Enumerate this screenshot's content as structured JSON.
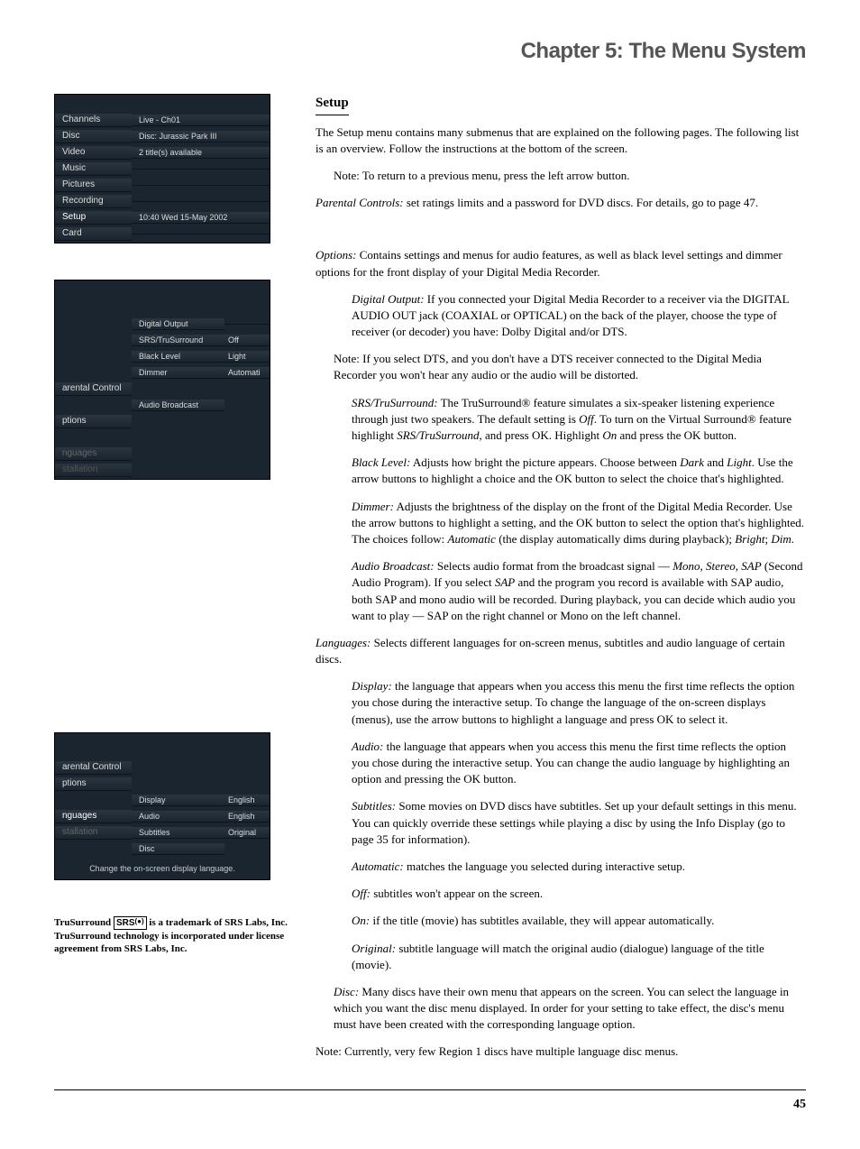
{
  "chapter_title": "Chapter 5: The Menu System",
  "setup": {
    "heading": "Setup",
    "intro": "The Setup menu contains many submenus that are explained on the following pages. The following list is an overview. Follow the instructions at the bottom of the screen.",
    "note_return": "Note: To return to a previous menu, press the left arrow button.",
    "parental_label": "Parental Controls:",
    "parental_text": " set ratings limits and a password for DVD discs. For details, go to page 47.",
    "options_label": "Options:",
    "options_text": " Contains settings and menus for audio features, as well as black level settings and dimmer options for the front display of your Digital Media Recorder.",
    "digital_output_label": "Digital Output:",
    "digital_output_text": "  If you connected your Digital Media Recorder to a receiver via the DIGITAL AUDIO OUT jack (COAXIAL or OPTICAL) on the back of the player, choose the type of receiver (or decoder) you have: Dolby Digital and/or DTS.",
    "dts_note": "Note: If you select DTS, and you don't have a DTS receiver connected to the Digital Media Recorder you won't hear any audio or the audio will be distorted.",
    "srs_label": "SRS/TruSurround:",
    "srs_text_1": "  The TruSurround® feature simulates a six-speaker listening experience through just two speakers. The default setting is ",
    "srs_off": "Off",
    "srs_text_2": ". To turn on the Virtual Surround® feature highlight ",
    "srs_highlight": "SRS/TruSurround",
    "srs_text_3": ", and press OK. Highlight ",
    "srs_on": "On",
    "srs_text_4": " and press the OK button.",
    "black_label": "Black Level:",
    "black_text_1": "  Adjusts how bright the picture appears. Choose between ",
    "black_dark": "Dark",
    "black_and": " and ",
    "black_light": "Light",
    "black_text_2": ". Use the arrow buttons to highlight a choice and the OK button to select the choice that's highlighted.",
    "dimmer_label": "Dimmer:",
    "dimmer_text_1": " Adjusts the brightness of the display on the front of the Digital Media Recorder. Use the arrow buttons to highlight a setting, and the OK button to select the option that's highlighted. The choices follow: ",
    "dimmer_auto": "Automatic",
    "dimmer_text_2": " (the display automatically dims during playback); ",
    "dimmer_bright": "Bright",
    "dimmer_semi": "; ",
    "dimmer_dim": "Dim",
    "dimmer_period": ".",
    "audio_bc_label": "Audio Broadcast:",
    "audio_bc_text_1": "  Selects audio format from the broadcast signal — ",
    "audio_bc_modes": "Mono, Stereo, SAP",
    "audio_bc_text_2": " (Second Audio Program). If you select ",
    "audio_bc_sap": "SAP",
    "audio_bc_text_3": " and the program you record is available with SAP audio, both SAP and mono audio will be recorded. During playback, you can decide which audio you want to play — SAP on the right channel or Mono on the left channel.",
    "lang_label": "Languages:",
    "lang_text": " Selects different languages for on-screen menus, subtitles and audio language of certain discs.",
    "display_label": "Display:",
    "display_text": " the language that appears when you access this menu the first time reflects the option you chose during the interactive setup. To change the language of the on-screen displays (menus), use the arrow buttons to highlight a language and press OK to select it.",
    "audio_label": "Audio:",
    "audio_text": " the language that appears when you access this menu the first time reflects the option you chose during the interactive setup. You can change the audio language by highlighting an option and pressing the OK button.",
    "subtitles_label": "Subtitles:",
    "subtitles_text": " Some movies on DVD discs have subtitles. Set up your default settings in this menu. You can quickly override these settings while playing a disc by using the Info Display (go to page 35 for information).",
    "sub_auto_label": "Automatic:",
    "sub_auto_text": " matches the language you selected during interactive setup.",
    "sub_off_label": "Off:",
    "sub_off_text": " subtitles won't appear on the screen.",
    "sub_on_label": "On:",
    "sub_on_text": " if the title (movie) has subtitles available, they will appear automatically.",
    "sub_orig_label": "Original:",
    "sub_orig_text": " subtitle language will match the original audio (dialogue) language of the title (movie).",
    "disc_label": "Disc:",
    "disc_text": " Many discs have their own menu that appears on the screen.  You can select the language in which you want the disc menu displayed. In order for your setting to take effect, the disc's menu must have been created with the corresponding language option.",
    "region_note": "Note: Currently, very few Region 1 discs have multiple language disc menus."
  },
  "ui1": {
    "items": [
      "Channels",
      "Disc",
      "Video",
      "Music",
      "Pictures",
      "Recording",
      "Setup",
      "Card"
    ],
    "right": [
      "Live - Ch01",
      "Disc: Jurassic Park III",
      "2 title(s) available",
      "",
      "",
      "",
      "10:40 Wed 15-May 2002",
      ""
    ]
  },
  "ui2": {
    "left": [
      "",
      "",
      "",
      "",
      "",
      "arental Control",
      "",
      "ptions",
      "",
      "nguages",
      "stallation"
    ],
    "mid_items": [
      "Digital Output",
      "SRS/TruSurround",
      "Black Level",
      "Dimmer",
      "",
      "Audio Broadcast"
    ],
    "values": [
      "",
      "Off",
      "Light",
      "Automati",
      "",
      ""
    ]
  },
  "ui3": {
    "left": [
      "arental Control",
      "ptions",
      "",
      "nguages",
      "stallation",
      ""
    ],
    "mid": [
      "",
      "",
      "Display",
      "Audio",
      "Subtitles",
      "Disc"
    ],
    "values": [
      "",
      "",
      "English",
      "English",
      "Original",
      ""
    ],
    "hint": "Change the on-screen display language."
  },
  "trademark": {
    "t1": "TruSurround ",
    "logo": "SRS",
    "t2": "  is a trademark of SRS Labs, Inc. TruSurround technology is incorporated under license agreement from SRS Labs, Inc."
  },
  "page_number": "45"
}
